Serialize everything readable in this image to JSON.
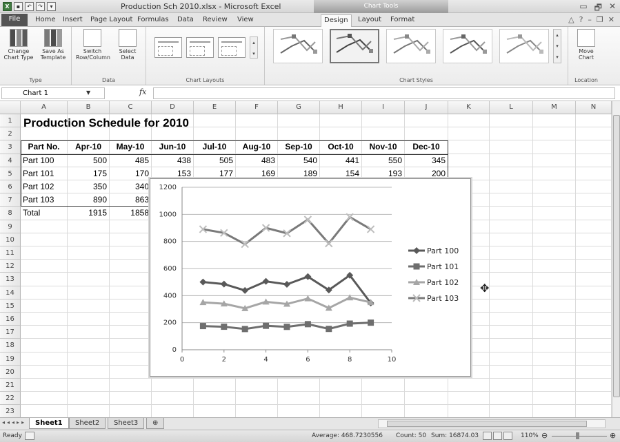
{
  "app": {
    "title": "Production Sch 2010.xlsx - Microsoft Excel",
    "context_tab": "Chart Tools",
    "window_controls": [
      "▭",
      "🗗",
      "✕"
    ]
  },
  "tabs": [
    "File",
    "Home",
    "Insert",
    "Page Layout",
    "Formulas",
    "Data",
    "Review",
    "View",
    "Design",
    "Layout",
    "Format"
  ],
  "active_tab": "Design",
  "ribbon": {
    "type_group": {
      "label": "Type",
      "change_chart_type": "Change Chart Type",
      "save_as_template": "Save As Template"
    },
    "data_group": {
      "label": "Data",
      "switch_row_column": "Switch Row/Column",
      "select_data": "Select Data"
    },
    "chart_layouts_label": "Chart Layouts",
    "chart_styles_label": "Chart Styles",
    "location_group": {
      "label": "Location",
      "move_chart": "Move Chart"
    }
  },
  "formula_bar": {
    "name_box": "Chart 1",
    "fx": "fx",
    "formula": ""
  },
  "sheet": {
    "columns": [
      "A",
      "B",
      "C",
      "D",
      "E",
      "F",
      "G",
      "H",
      "I",
      "J",
      "K",
      "L",
      "M",
      "N"
    ],
    "rows": [
      "1",
      "2",
      "3",
      "4",
      "5",
      "6",
      "7",
      "8",
      "9",
      "10",
      "11",
      "12",
      "13",
      "14",
      "15",
      "16",
      "17",
      "18",
      "19",
      "20",
      "21",
      "22",
      "23"
    ],
    "title": "Production Schedule for 2010",
    "header": [
      "Part No.",
      "Apr-10",
      "May-10",
      "Jun-10",
      "Jul-10",
      "Aug-10",
      "Sep-10",
      "Oct-10",
      "Nov-10",
      "Dec-10"
    ],
    "data_rows": [
      [
        "Part 100",
        "500",
        "485",
        "438",
        "505",
        "483",
        "540",
        "441",
        "550",
        "345"
      ],
      [
        "Part 101",
        "175",
        "170",
        "153",
        "177",
        "169",
        "189",
        "154",
        "193",
        "200"
      ],
      [
        "Part 102",
        "350",
        "340"
      ],
      [
        "Part 103",
        "890",
        "863"
      ],
      [
        "Total",
        "1915",
        "1858"
      ]
    ]
  },
  "chart_data": {
    "type": "line",
    "x": [
      1,
      2,
      3,
      4,
      5,
      6,
      7,
      8,
      9
    ],
    "xlim": [
      0,
      10
    ],
    "ylim": [
      0,
      1200
    ],
    "x_ticks": [
      "0",
      "2",
      "4",
      "6",
      "8",
      "10"
    ],
    "y_ticks": [
      "0",
      "200",
      "400",
      "600",
      "800",
      "1000",
      "1200"
    ],
    "grid": true,
    "legend_position": "right",
    "series": [
      {
        "name": "Part 100",
        "values": [
          500,
          485,
          438,
          505,
          483,
          540,
          441,
          550,
          345
        ],
        "color": "#595959",
        "marker": "diamond"
      },
      {
        "name": "Part 101",
        "values": [
          175,
          170,
          153,
          177,
          169,
          189,
          154,
          193,
          200
        ],
        "color": "#6e6e6e",
        "marker": "square"
      },
      {
        "name": "Part 102",
        "values": [
          350,
          340,
          306,
          354,
          338,
          378,
          308,
          385,
          350
        ],
        "color": "#a6a6a6",
        "marker": "triangle"
      },
      {
        "name": "Part 103",
        "values": [
          890,
          863,
          780,
          900,
          860,
          961,
          785,
          980,
          890
        ],
        "color": "#7a7a7a",
        "marker": "x"
      }
    ]
  },
  "sheet_tabs": [
    "Sheet1",
    "Sheet2",
    "Sheet3"
  ],
  "active_sheet": "Sheet1",
  "status": {
    "ready": "Ready",
    "average": "Average: 468.7230556",
    "count": "Count: 50",
    "sum": "Sum: 16874.03",
    "zoom": "110%"
  }
}
